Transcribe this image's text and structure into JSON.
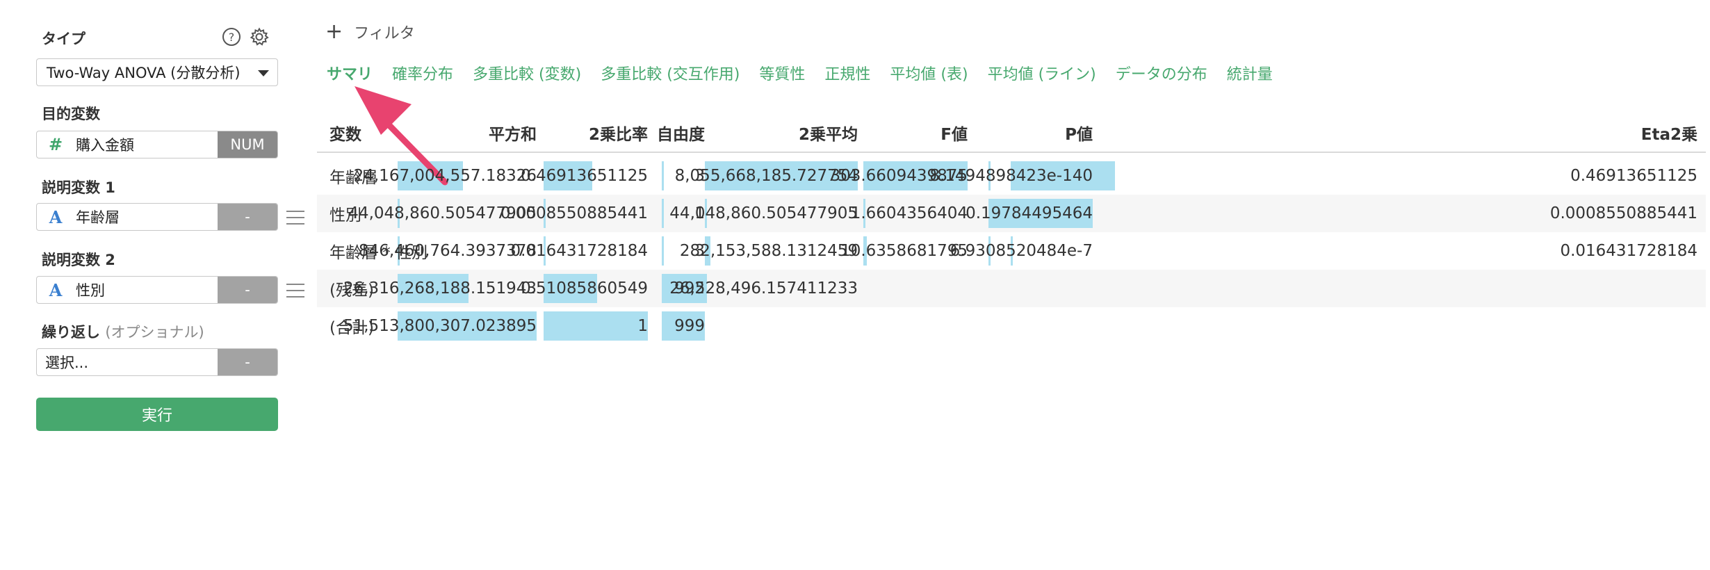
{
  "panel": {
    "type_label": "タイプ",
    "type_value": "Two-Way ANOVA (分散分析)",
    "target_label": "目的変数",
    "target_value": "購入金額",
    "target_tag": "NUM",
    "target_icon": "#",
    "exp1_label": "説明変数 1",
    "exp1_value": "年齢層",
    "exp1_tag": "-",
    "exp1_icon": "A",
    "exp2_label": "説明変数 2",
    "exp2_value": "性別",
    "exp2_tag": "-",
    "exp2_icon": "A",
    "repeat_label": "繰り返し",
    "repeat_optional": "(オプショナル)",
    "repeat_value": "選択...",
    "repeat_tag": "-",
    "run_label": "実行"
  },
  "filter_label": "フィルタ",
  "tabs": [
    "サマリ",
    "確率分布",
    "多重比較 (変数)",
    "多重比較 (交互作用)",
    "等質性",
    "正規性",
    "平均値 (表)",
    "平均値 (ライン)",
    "データの分布",
    "統計量"
  ],
  "active_tab": "サマリ",
  "table": {
    "columns": [
      "変数",
      "平方和",
      "2乗比率",
      "自由度",
      "2乗平均",
      "F値",
      "P値",
      "Eta2乗"
    ],
    "rows": [
      [
        "年齢層",
        "24,167,004,557.18326",
        "0.46913651125",
        "3",
        "8,055,668,185.727754",
        "303.6609439875",
        "8.1494898423e-140",
        "0.46913651125"
      ],
      [
        "性別",
        "44,048,860.505477905",
        "0.0008550885441",
        "1",
        "44,048,860.505477905",
        "1.6604356404",
        "0.19784495464",
        "0.0008550885441"
      ],
      [
        "年齢層 * 性別",
        "846,460,764.3937378",
        "0.016431728184",
        "3",
        "282,153,588.1312459",
        "10.6358681795",
        "6.9308520484e-7",
        "0.016431728184"
      ],
      [
        "(残差)",
        "26,316,268,188.151943",
        "0.51085860549",
        "992",
        "26,528,496.157411233",
        "",
        "",
        ""
      ],
      [
        "(合計)",
        "51,513,800,307.023895",
        "1",
        "999",
        "",
        "",
        "",
        ""
      ]
    ],
    "bar_fractions": [
      [
        null,
        0.469,
        0.469,
        0.004,
        1.0,
        1.0,
        0.0,
        1.0
      ],
      [
        null,
        0.0009,
        0.0009,
        0.001,
        0.005,
        0.005,
        1.0,
        0.0009
      ],
      [
        null,
        0.016,
        0.016,
        0.003,
        0.035,
        0.035,
        0.0,
        0.016
      ],
      [
        null,
        0.511,
        0.511,
        0.993,
        0.0,
        null,
        null,
        null
      ],
      [
        null,
        1.0,
        1.0,
        1.0,
        null,
        null,
        null,
        null
      ]
    ]
  },
  "colors": {
    "accent": "#47a86e",
    "bar": "#abdff0",
    "arrow": "#e8436f"
  }
}
